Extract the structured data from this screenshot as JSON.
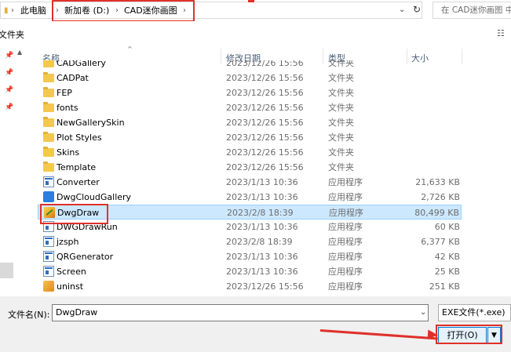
{
  "address": {
    "crumbs": [
      "此电脑",
      "新加卷 (D:)",
      "CAD迷你画图"
    ],
    "search_placeholder": "在 CAD迷你画图 中"
  },
  "toolbar": {
    "new_folder": "文件夹"
  },
  "columns": {
    "name": "名称",
    "date": "修改日期",
    "type": "类型",
    "size": "大小"
  },
  "files": [
    {
      "name": "CADGallery",
      "date": "2023/12/26 15:56",
      "type": "文件夹",
      "size": "",
      "icon": "folder-icon"
    },
    {
      "name": "CADPat",
      "date": "2023/12/26 15:56",
      "type": "文件夹",
      "size": "",
      "icon": "folder-icon"
    },
    {
      "name": "FEP",
      "date": "2023/12/26 15:56",
      "type": "文件夹",
      "size": "",
      "icon": "folder-icon"
    },
    {
      "name": "fonts",
      "date": "2023/12/26 15:56",
      "type": "文件夹",
      "size": "",
      "icon": "folder-icon"
    },
    {
      "name": "NewGallerySkin",
      "date": "2023/12/26 15:56",
      "type": "文件夹",
      "size": "",
      "icon": "folder-icon"
    },
    {
      "name": "Plot Styles",
      "date": "2023/12/26 15:56",
      "type": "文件夹",
      "size": "",
      "icon": "folder-icon"
    },
    {
      "name": "Skins",
      "date": "2023/12/26 15:56",
      "type": "文件夹",
      "size": "",
      "icon": "folder-icon"
    },
    {
      "name": "Template",
      "date": "2023/12/26 15:56",
      "type": "文件夹",
      "size": "",
      "icon": "folder-icon"
    },
    {
      "name": "Converter",
      "date": "2023/1/13 10:36",
      "type": "应用程序",
      "size": "21,633 KB",
      "icon": "app-icon"
    },
    {
      "name": "DwgCloudGallery",
      "date": "2023/1/13 10:36",
      "type": "应用程序",
      "size": "2,726 KB",
      "icon": "cloud-app-icon"
    },
    {
      "name": "DwgDraw",
      "date": "2023/2/8 18:39",
      "type": "应用程序",
      "size": "80,499 KB",
      "icon": "dwgdraw-icon",
      "selected": true
    },
    {
      "name": "DWGDrawRun",
      "date": "2023/1/13 10:36",
      "type": "应用程序",
      "size": "60 KB",
      "icon": "app-icon"
    },
    {
      "name": "jzsph",
      "date": "2023/2/8 18:39",
      "type": "应用程序",
      "size": "6,377 KB",
      "icon": "app-icon"
    },
    {
      "name": "QRGenerator",
      "date": "2023/1/13 10:36",
      "type": "应用程序",
      "size": "42 KB",
      "icon": "app-icon"
    },
    {
      "name": "Screen",
      "date": "2023/1/13 10:36",
      "type": "应用程序",
      "size": "25 KB",
      "icon": "app-icon"
    },
    {
      "name": "uninst",
      "date": "2023/12/26 15:56",
      "type": "应用程序",
      "size": "251 KB",
      "icon": "uninstall-icon"
    }
  ],
  "bottom": {
    "filename_label": "文件名(N):",
    "filename_value": "DwgDraw",
    "filter": "EXE文件(*.exe)",
    "open_label": "打开(O)"
  },
  "colors": {
    "annotation": "#e0302a",
    "selection": "#cce8ff",
    "accent": "#0078d7",
    "folder": "#f3c94d"
  }
}
